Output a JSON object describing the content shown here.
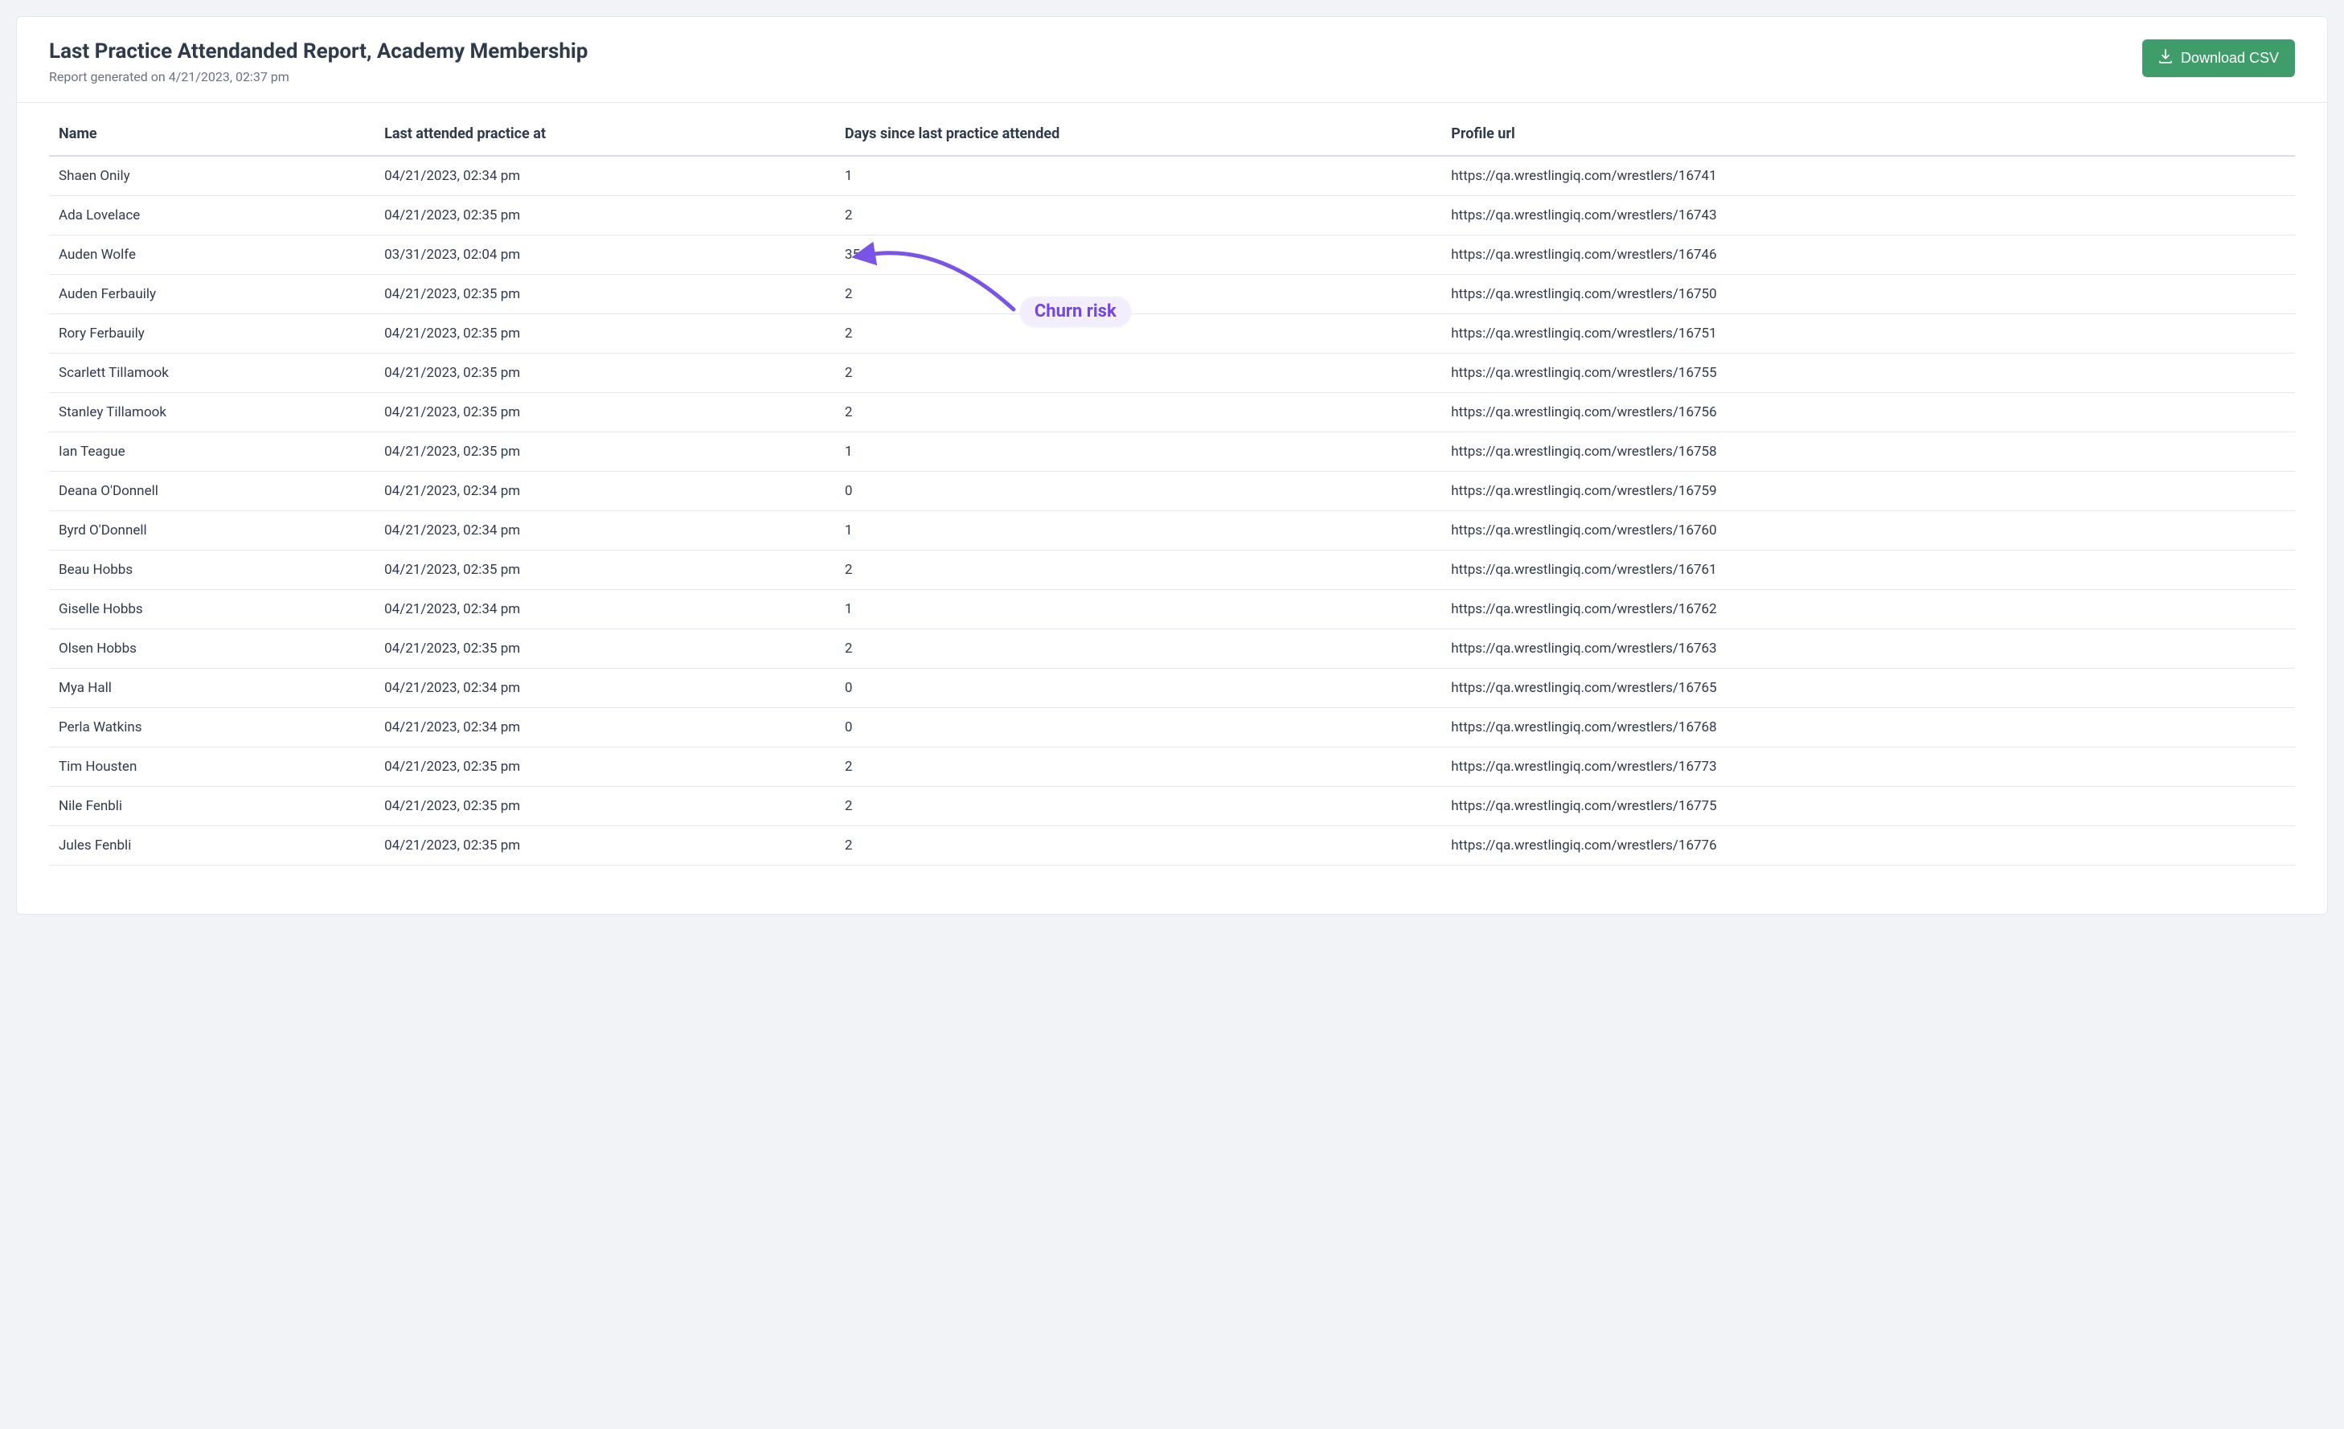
{
  "header": {
    "title": "Last Practice Attendanded Report, Academy Membership",
    "subtitle": "Report generated on 4/21/2023, 02:37 pm",
    "download_label": "Download CSV"
  },
  "table": {
    "columns": {
      "name": "Name",
      "last_attended": "Last attended practice at",
      "days_since": "Days since last practice attended",
      "profile_url": "Profile url"
    },
    "rows": [
      {
        "name": "Shaen Onily",
        "last_attended": "04/21/2023, 02:34 pm",
        "days_since": "1",
        "profile_url": "https://qa.wrestlingiq.com/wrestlers/16741"
      },
      {
        "name": "Ada Lovelace",
        "last_attended": "04/21/2023, 02:35 pm",
        "days_since": "2",
        "profile_url": "https://qa.wrestlingiq.com/wrestlers/16743"
      },
      {
        "name": "Auden Wolfe",
        "last_attended": "03/31/2023, 02:04 pm",
        "days_since": "35",
        "profile_url": "https://qa.wrestlingiq.com/wrestlers/16746"
      },
      {
        "name": "Auden Ferbauily",
        "last_attended": "04/21/2023, 02:35 pm",
        "days_since": "2",
        "profile_url": "https://qa.wrestlingiq.com/wrestlers/16750"
      },
      {
        "name": "Rory Ferbauily",
        "last_attended": "04/21/2023, 02:35 pm",
        "days_since": "2",
        "profile_url": "https://qa.wrestlingiq.com/wrestlers/16751"
      },
      {
        "name": "Scarlett Tillamook",
        "last_attended": "04/21/2023, 02:35 pm",
        "days_since": "2",
        "profile_url": "https://qa.wrestlingiq.com/wrestlers/16755"
      },
      {
        "name": "Stanley Tillamook",
        "last_attended": "04/21/2023, 02:35 pm",
        "days_since": "2",
        "profile_url": "https://qa.wrestlingiq.com/wrestlers/16756"
      },
      {
        "name": "Ian Teague",
        "last_attended": "04/21/2023, 02:35 pm",
        "days_since": "1",
        "profile_url": "https://qa.wrestlingiq.com/wrestlers/16758"
      },
      {
        "name": "Deana O'Donnell",
        "last_attended": "04/21/2023, 02:34 pm",
        "days_since": "0",
        "profile_url": "https://qa.wrestlingiq.com/wrestlers/16759"
      },
      {
        "name": "Byrd O'Donnell",
        "last_attended": "04/21/2023, 02:34 pm",
        "days_since": "1",
        "profile_url": "https://qa.wrestlingiq.com/wrestlers/16760"
      },
      {
        "name": "Beau Hobbs",
        "last_attended": "04/21/2023, 02:35 pm",
        "days_since": "2",
        "profile_url": "https://qa.wrestlingiq.com/wrestlers/16761"
      },
      {
        "name": "Giselle Hobbs",
        "last_attended": "04/21/2023, 02:34 pm",
        "days_since": "1",
        "profile_url": "https://qa.wrestlingiq.com/wrestlers/16762"
      },
      {
        "name": "Olsen Hobbs",
        "last_attended": "04/21/2023, 02:35 pm",
        "days_since": "2",
        "profile_url": "https://qa.wrestlingiq.com/wrestlers/16763"
      },
      {
        "name": "Mya Hall",
        "last_attended": "04/21/2023, 02:34 pm",
        "days_since": "0",
        "profile_url": "https://qa.wrestlingiq.com/wrestlers/16765"
      },
      {
        "name": "Perla Watkins",
        "last_attended": "04/21/2023, 02:34 pm",
        "days_since": "0",
        "profile_url": "https://qa.wrestlingiq.com/wrestlers/16768"
      },
      {
        "name": "Tim Housten",
        "last_attended": "04/21/2023, 02:35 pm",
        "days_since": "2",
        "profile_url": "https://qa.wrestlingiq.com/wrestlers/16773"
      },
      {
        "name": "Nile Fenbli",
        "last_attended": "04/21/2023, 02:35 pm",
        "days_since": "2",
        "profile_url": "https://qa.wrestlingiq.com/wrestlers/16775"
      },
      {
        "name": "Jules Fenbli",
        "last_attended": "04/21/2023, 02:35 pm",
        "days_since": "2",
        "profile_url": "https://qa.wrestlingiq.com/wrestlers/16776"
      }
    ]
  },
  "annotation": {
    "label": "Churn risk"
  }
}
